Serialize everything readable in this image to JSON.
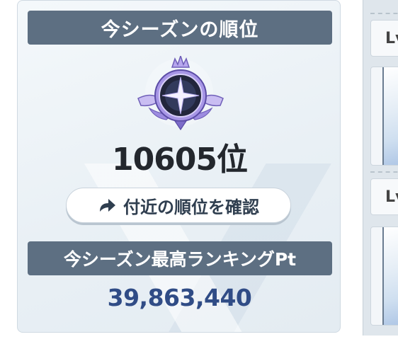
{
  "rank_panel": {
    "header": "今シーズンの順位",
    "rank": "10605位",
    "nearby_button_label": "付近の順位を確認",
    "best_header": "今シーズン最高ランキングPt",
    "best_points": "39,863,440"
  },
  "side_panel": {
    "level_labels": [
      "Lv",
      "Lv"
    ]
  },
  "icons": {
    "emblem": "rank-emblem-icon",
    "button": "share-arrow-icon"
  },
  "colors": {
    "header_bar": "#5d6f82",
    "rank_text": "#23272d",
    "points_text": "#304c86",
    "emblem_purple": "#8c7bd6"
  }
}
